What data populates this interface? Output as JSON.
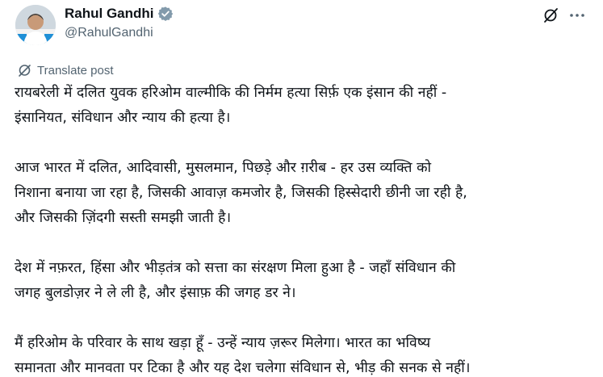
{
  "author": {
    "display_name": "Rahul Gandhi",
    "handle": "@RahulGandhi",
    "verified_color": "#829aab"
  },
  "actions": {
    "grok": "grok-icon",
    "more": "more-icon"
  },
  "translate": {
    "label": "Translate post"
  },
  "post": {
    "paragraphs": [
      [
        "रायबरेली में दलित युवक हरिओम वाल्मीकि की निर्मम हत्या सिर्फ़ एक इंसान की नहीं -",
        "इंसानियत, संविधान और न्याय की हत्या है।"
      ],
      [
        "आज भारत में दलित, आदिवासी, मुसलमान, पिछड़े और ग़रीब - हर उस व्यक्ति को",
        "निशाना बनाया जा रहा है, जिसकी आवाज़ कमजोर है, जिसकी हिस्सेदारी छीनी जा रही है,",
        "और जिसकी ज़िंदगी सस्ती समझी जाती है।"
      ],
      [
        "देश में नफ़रत, हिंसा और भीड़तंत्र को सत्ता का संरक्षण मिला हुआ है - जहाँ संविधान की",
        "जगह बुलडोज़र ने ले ली है, और इंसाफ़ की जगह डर ने।"
      ],
      [
        "मैं हरिओम के परिवार के साथ खड़ा हूँ - उन्हें न्याय ज़रूर मिलेगा। भारत का भविष्य",
        "समानता और मानवता पर टिका है और यह देश चलेगा संविधान से, भीड़ की सनक से नहीं।"
      ]
    ]
  }
}
